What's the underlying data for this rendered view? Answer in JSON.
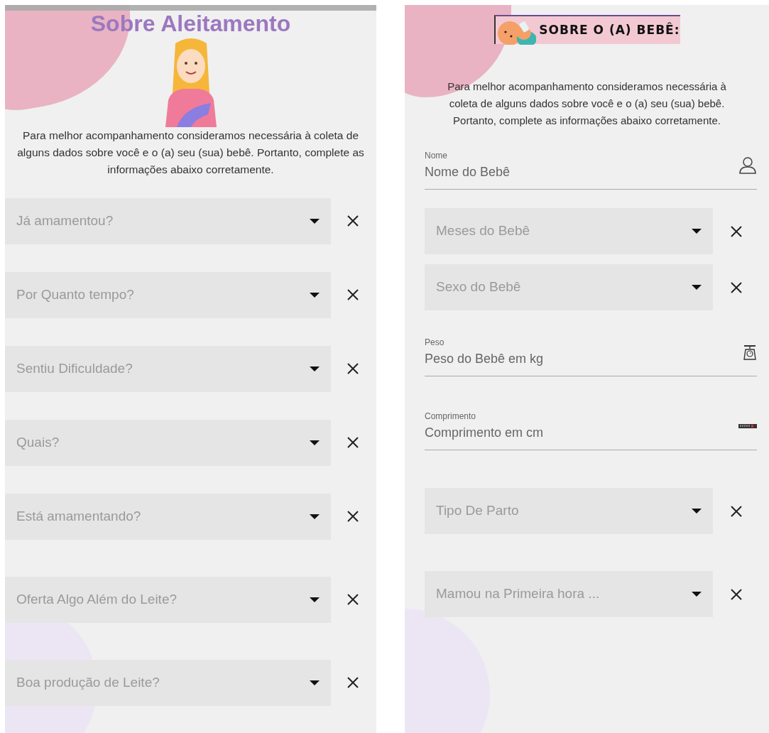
{
  "screens": [
    {
      "kind": "plain",
      "title": "Sobre Aleitamento",
      "intro": "Para melhor acompanhamento consideramos necessária à coleta de alguns dados sobre você e o (a) seu (sua) bebê. Portanto, complete as informações abaixo corretamente.",
      "fields": [
        {
          "kind": "select",
          "placeholder": "Já amamentou?"
        },
        {
          "kind": "select",
          "placeholder": "Por Quanto tempo?"
        },
        {
          "kind": "select",
          "placeholder": "Sentiu Dificuldade?"
        },
        {
          "kind": "select",
          "placeholder": "Quais?"
        },
        {
          "kind": "select",
          "placeholder": "Está amamentando?"
        },
        {
          "kind": "select",
          "placeholder": "Oferta Algo Além do Leite?"
        },
        {
          "kind": "select",
          "placeholder": "Boa produção de Leite?"
        }
      ]
    },
    {
      "kind": "banner",
      "title": "SOBRE O (A) BEBÊ:",
      "intro": "Para melhor acompanhamento consideramos necessária à coleta de alguns dados sobre você e o (a) seu (sua) bebê. Portanto, complete as informações abaixo corretamente.",
      "fields": [
        {
          "kind": "text",
          "label": "Nome",
          "placeholder": "Nome do Bebê"
        },
        {
          "kind": "select",
          "placeholder": "Meses do Bebê"
        },
        {
          "kind": "select",
          "placeholder": "Sexo do Bebê"
        },
        {
          "kind": "text",
          "label": "Peso",
          "placeholder": "Peso do Bebê em kg"
        },
        {
          "kind": "text",
          "label": "Comprimento",
          "placeholder": "Comprimento em cm"
        },
        {
          "kind": "select",
          "placeholder": "Tipo De Parto"
        },
        {
          "kind": "select",
          "placeholder": "Mamou na Primeira hora ..."
        }
      ]
    }
  ]
}
